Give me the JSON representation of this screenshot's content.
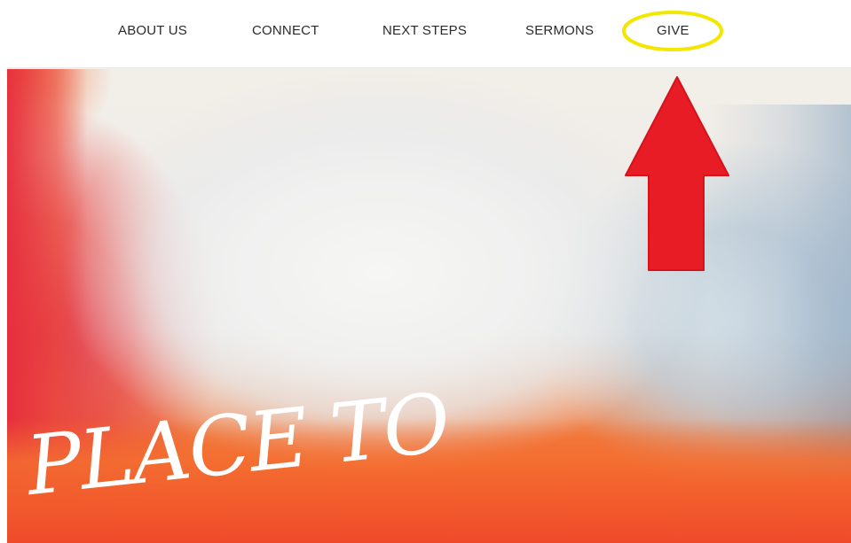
{
  "nav": {
    "items": [
      {
        "label": "ABOUT US"
      },
      {
        "label": "CONNECT"
      },
      {
        "label": "NEXT STEPS"
      },
      {
        "label": "SERMONS"
      },
      {
        "label": "GIVE"
      }
    ]
  },
  "hero": {
    "script_text": "PLACE TO"
  },
  "annotations": {
    "highlight_color": "#f3e600",
    "arrow_color": "#e81c24",
    "highlight_target": "GIVE"
  }
}
